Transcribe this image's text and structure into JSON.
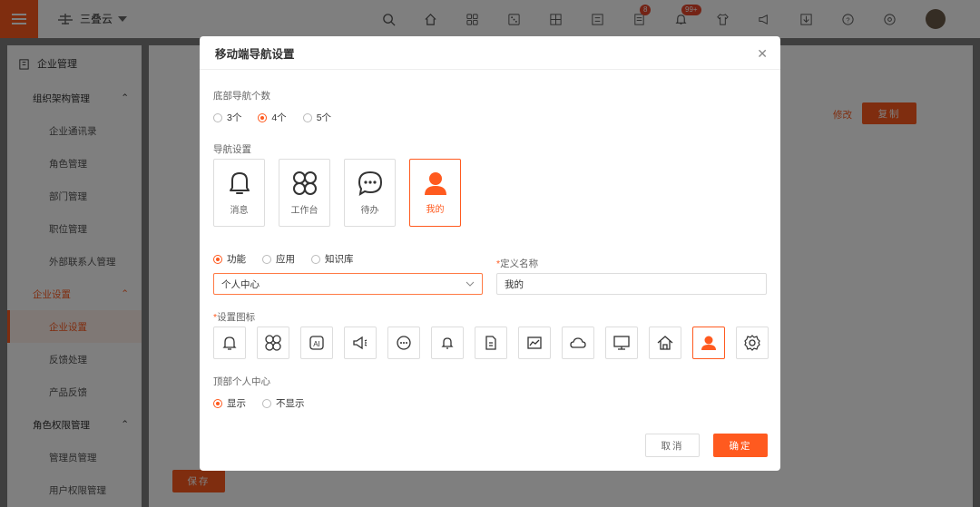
{
  "app": {
    "brand": "三叠云"
  },
  "topbar": {
    "badges": {
      "doc": "8",
      "bell": "99+"
    }
  },
  "sidebar": {
    "title": "企业管理",
    "items": [
      {
        "label": "组织架构管理",
        "type": "group"
      },
      {
        "label": "企业通讯录",
        "type": "item"
      },
      {
        "label": "角色管理",
        "type": "item"
      },
      {
        "label": "部门管理",
        "type": "item"
      },
      {
        "label": "职位管理",
        "type": "item"
      },
      {
        "label": "外部联系人管理",
        "type": "item"
      },
      {
        "label": "企业设置",
        "type": "group-active"
      },
      {
        "label": "企业设置",
        "type": "active"
      },
      {
        "label": "反馈处理",
        "type": "item"
      },
      {
        "label": "产品反馈",
        "type": "item"
      },
      {
        "label": "角色权限管理",
        "type": "group"
      },
      {
        "label": "管理员管理",
        "type": "item"
      },
      {
        "label": "用户权限管理",
        "type": "item"
      }
    ]
  },
  "page": {
    "edit_label": "修改",
    "copy_label": "复制",
    "save_label": "保存"
  },
  "modal": {
    "title": "移动端导航设置",
    "count_label": "底部导航个数",
    "count_options": [
      {
        "label": "3个",
        "checked": false
      },
      {
        "label": "4个",
        "checked": true
      },
      {
        "label": "5个",
        "checked": false
      }
    ],
    "nav_label": "导航设置",
    "nav_cards": [
      {
        "label": "消息",
        "icon": "bell-icon",
        "selected": false
      },
      {
        "label": "工作台",
        "icon": "apps-icon",
        "selected": false
      },
      {
        "label": "待办",
        "icon": "chat-icon",
        "selected": false
      },
      {
        "label": "我的",
        "icon": "user-icon",
        "selected": true
      }
    ],
    "type_options": [
      {
        "label": "功能",
        "checked": true
      },
      {
        "label": "应用",
        "checked": false
      },
      {
        "label": "知识库",
        "checked": false
      }
    ],
    "custom_name_label": "定义名称",
    "function_select": "个人中心",
    "custom_name_value": "我的",
    "icon_label": "设置图标",
    "icons": [
      "bell-icon",
      "apps-icon",
      "ai-icon",
      "megaphone-icon",
      "chat-icon",
      "bell-small-icon",
      "document-icon",
      "chart-icon",
      "cloud-icon",
      "monitor-icon",
      "home-icon",
      "user-icon",
      "settings-icon"
    ],
    "selected_icon": "user-icon",
    "top_center_label": "顶部个人中心",
    "top_center_options": [
      {
        "label": "显示",
        "checked": true
      },
      {
        "label": "不显示",
        "checked": false
      }
    ],
    "cancel_label": "取消",
    "ok_label": "确定"
  },
  "colors": {
    "accent": "#ff5a1f"
  }
}
